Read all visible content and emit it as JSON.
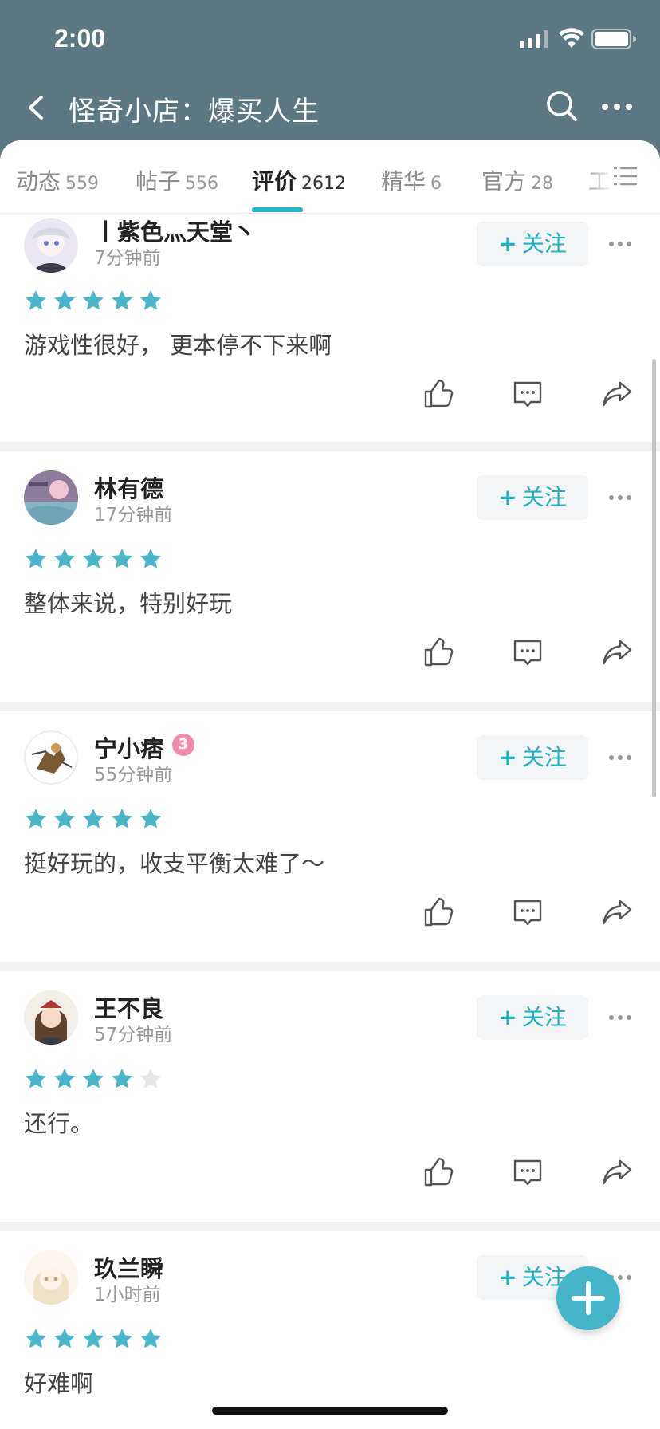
{
  "status_bar": {
    "time": "2:00"
  },
  "header": {
    "title": "怪奇小店：爆买人生"
  },
  "tabs": [
    {
      "label": "动态",
      "count": "559"
    },
    {
      "label": "帖子",
      "count": "556"
    },
    {
      "label": "评价",
      "count": "2612",
      "active": true
    },
    {
      "label": "精华",
      "count": "6"
    },
    {
      "label": "官方",
      "count": "28"
    },
    {
      "label": "工"
    }
  ],
  "follow_label": "关注",
  "colors": {
    "header_bg": "#5e7883",
    "accent": "#26b6c9",
    "star": "#4bb5c9",
    "fab": "#45b5c9"
  },
  "reviews": [
    {
      "username": "丨紫色灬天堂丶",
      "time": "7分钟前",
      "rating": 5,
      "text": "游戏性很好， 更本停不下来啊"
    },
    {
      "username": "林有德",
      "time": "17分钟前",
      "rating": 5,
      "text": "整体来说，特别好玩"
    },
    {
      "username": "宁小痞",
      "time": "55分钟前",
      "rating": 5,
      "text": "挺好玩的，收支平衡太难了～",
      "badge": "3"
    },
    {
      "username": "王不良",
      "time": "57分钟前",
      "rating": 4,
      "text": "还行。"
    },
    {
      "username": "玖兰瞬",
      "time": "1小时前",
      "rating": 5,
      "text": "好难啊"
    }
  ]
}
